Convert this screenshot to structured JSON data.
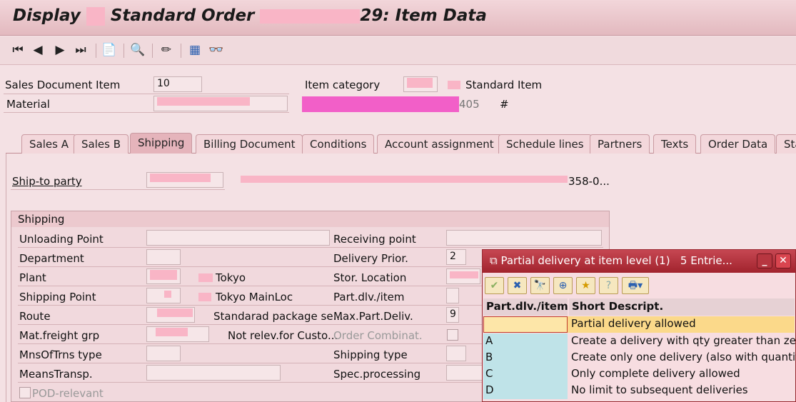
{
  "window": {
    "title_prefix": "Display ",
    "title_mid": " Standard Order ",
    "title_suffix": "29: Item Data"
  },
  "toolbar": {
    "icons": [
      "first-page-icon",
      "previous-icon",
      "next-icon",
      "last-page-icon",
      "document-flow-icon",
      "status-overview-icon",
      "edit-item-icon",
      "calculator-icon",
      "display-glasses-icon"
    ]
  },
  "header": {
    "sales_document_item_label": "Sales Document Item",
    "sales_document_item_value": "10",
    "material_label": "Material",
    "item_category_label": "Item category",
    "item_category_text": "Standard Item",
    "material_desc_suffix": "405",
    "hash": "#"
  },
  "tabs": [
    "Sales A",
    "Sales B",
    "Shipping",
    "Billing Document",
    "Conditions",
    "Account assignment",
    "Schedule lines",
    "Partners",
    "Texts",
    "Order Data",
    "Sta"
  ],
  "active_tab": "Shipping",
  "ship_to": {
    "label": "Ship-to party",
    "address_suffix": "358-0..."
  },
  "shipping_group": {
    "title": "Shipping",
    "left": {
      "unloading_point": "Unloading Point",
      "department": "Department",
      "plant": "Plant",
      "plant_text": "Tokyo",
      "shipping_point": "Shipping Point",
      "shipping_point_text": "Tokyo MainLoc",
      "route": "Route",
      "route_text": "Standarad package se...",
      "mat_freight_grp": "Mat.freight grp",
      "mat_freight_text": "Not relev.for Custo...",
      "mns_of_trns_type": "MnsOfTrns type",
      "means_transp": "MeansTransp.",
      "pod_relevant": "POD-relevant"
    },
    "right": {
      "receiving_point": "Receiving point",
      "delivery_prior": "Delivery Prior.",
      "delivery_prior_value": "2",
      "stor_location": "Stor. Location",
      "part_dlv_item": "Part.dlv./item",
      "max_part_deliv": "Max.Part.Deliv.",
      "max_part_deliv_value": "9",
      "order_combinat": "Order Combinat.",
      "shipping_type": "Shipping type",
      "spec_processing": "Spec.processing"
    }
  },
  "popup": {
    "title": "Partial delivery at item level (1)   5 Entrie...",
    "columns": [
      "Part.dlv./item",
      "Short Descript."
    ],
    "rows": [
      {
        "code": "",
        "desc": "Partial delivery allowed"
      },
      {
        "code": "A",
        "desc": "Create a delivery with qty greater than zero"
      },
      {
        "code": "B",
        "desc": "Create only one delivery (also with quantity"
      },
      {
        "code": "C",
        "desc": "Only complete delivery allowed"
      },
      {
        "code": "D",
        "desc": "No limit to subsequent deliveries"
      }
    ],
    "toolbar_icons": [
      "checkmark-icon",
      "cancel-icon",
      "find-icon",
      "find-next-icon",
      "add-favorite-icon",
      "help-icon",
      "print-icon"
    ],
    "selected_row_color": "#fbd98a"
  }
}
